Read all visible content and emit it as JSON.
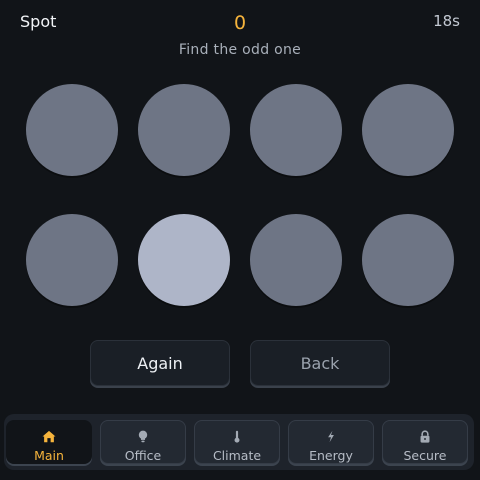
{
  "header": {
    "title": "Spot",
    "score": "0",
    "timer": "18s",
    "prompt": "Find the odd one"
  },
  "grid": {
    "cells": [
      {
        "color": "#6e7585",
        "odd": false
      },
      {
        "color": "#6e7585",
        "odd": false
      },
      {
        "color": "#6e7585",
        "odd": false
      },
      {
        "color": "#6e7585",
        "odd": false
      },
      {
        "color": "#6e7585",
        "odd": false
      },
      {
        "color": "#aeb5c8",
        "odd": true
      },
      {
        "color": "#6e7585",
        "odd": false
      },
      {
        "color": "#6e7585",
        "odd": false
      }
    ]
  },
  "buttons": {
    "again_label": "Again",
    "back_label": "Back"
  },
  "nav": {
    "accent_color": "#f6b43c",
    "tabs": [
      {
        "label": "Main",
        "icon": "home-icon",
        "active": true
      },
      {
        "label": "Office",
        "icon": "lightbulb-icon",
        "active": false
      },
      {
        "label": "Climate",
        "icon": "thermometer-icon",
        "active": false
      },
      {
        "label": "Energy",
        "icon": "lightning-icon",
        "active": false
      },
      {
        "label": "Secure",
        "icon": "lock-icon",
        "active": false
      }
    ]
  }
}
